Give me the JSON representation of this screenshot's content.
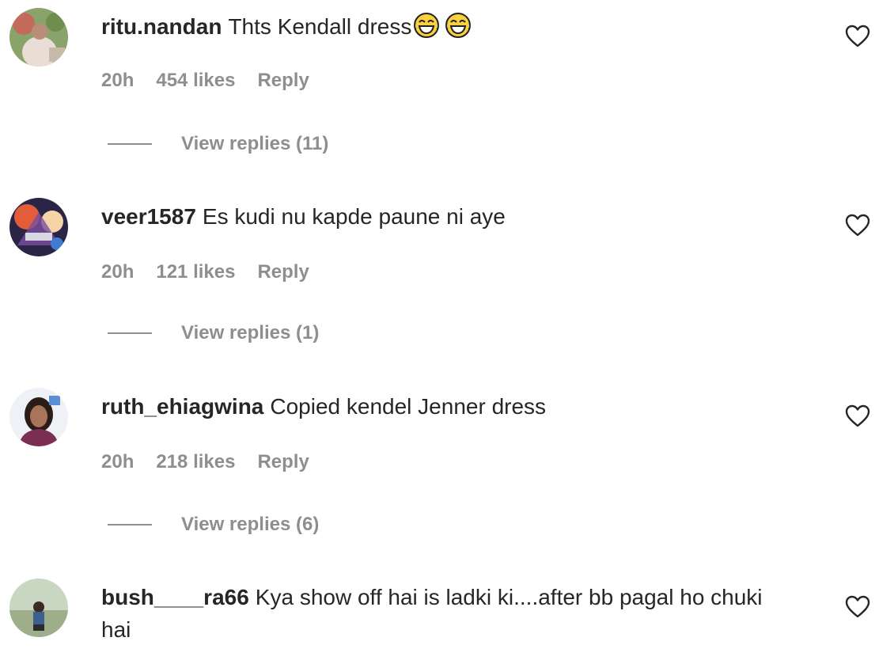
{
  "comments": [
    {
      "username": "ritu.nandan",
      "text": "Thts Kendall dress",
      "emoji": [
        "face-with-tears-of-joy",
        "face-with-tears-of-joy"
      ],
      "time": "20h",
      "likes": "454 likes",
      "reply_label": "Reply",
      "view_replies": "View replies (11)"
    },
    {
      "username": "veer1587",
      "text": "Es kudi nu kapde paune ni aye",
      "time": "20h",
      "likes": "121 likes",
      "reply_label": "Reply",
      "view_replies": "View replies (1)"
    },
    {
      "username": "ruth_ehiagwina",
      "text": "Copied kendel Jenner dress",
      "time": "20h",
      "likes": "218 likes",
      "reply_label": "Reply",
      "view_replies": "View replies (6)"
    },
    {
      "username": "bush____ra66",
      "text": "Kya show off hai is ladki ki....after bb pagal ho chuki hai"
    }
  ],
  "icons": {
    "like": "heart-outline-icon",
    "emoji": "face-with-tears-of-joy"
  },
  "colors": {
    "text": "#262626",
    "secondary": "#8e8e8e"
  }
}
